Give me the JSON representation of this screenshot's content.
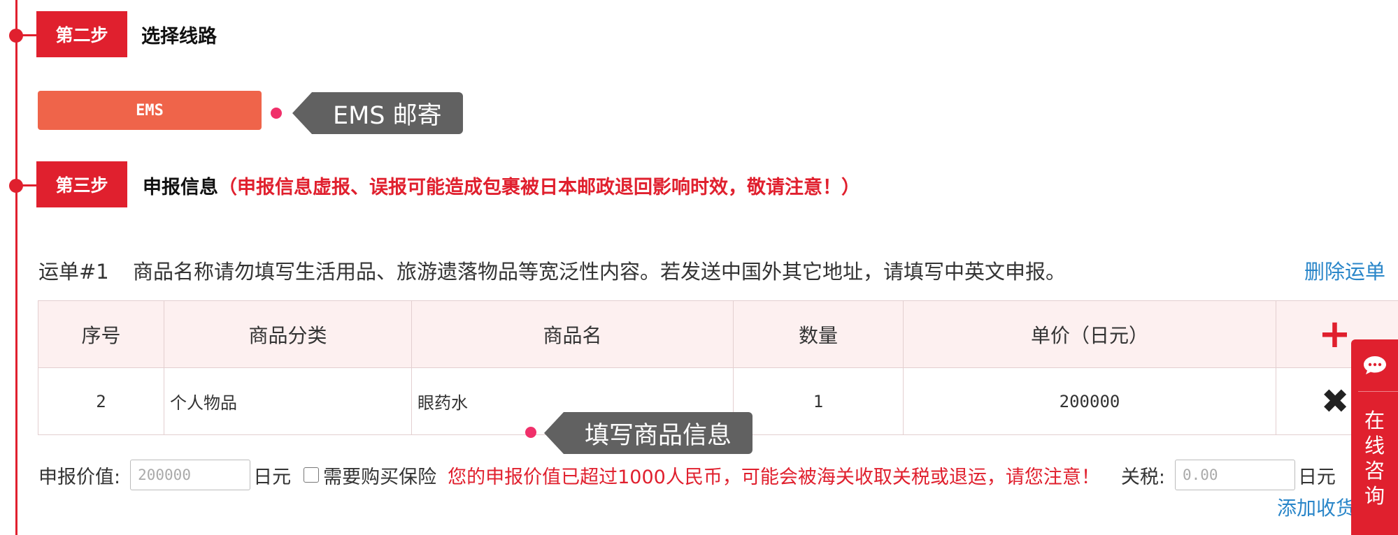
{
  "step2": {
    "badge": "第二步",
    "title": "选择线路"
  },
  "route": {
    "button_label": "EMS",
    "tooltip": "EMS 邮寄"
  },
  "step3": {
    "badge": "第三步",
    "title": "申报信息",
    "warning": "（申报信息虚报、误报可能造成包裹被日本邮政退回影响时效，敬请注意！）"
  },
  "waybill": {
    "label": "运单#1",
    "note": "商品名称请勿填写生活用品、旅游遗落物品等宽泛性内容。若发送中国外其它地址，请填写中英文申报。",
    "delete_label": "删除运单"
  },
  "table": {
    "headers": [
      "序号",
      "商品分类",
      "商品名",
      "数量",
      "单价（日元）"
    ],
    "add_icon": "plus-icon",
    "rows": [
      {
        "index": "2",
        "category": "个人物品",
        "name": "眼药水",
        "quantity": "1",
        "price": "200000",
        "remove_icon": "cross-icon"
      }
    ],
    "tooltip": "填写商品信息"
  },
  "declaration": {
    "value_label": "申报价值:",
    "value_placeholder": "200000",
    "currency": "日元",
    "insurance_label": "需要购买保险",
    "warning": "您的申报价值已超过1000人民币，可能会被海关收取关税或退运，请您注意！",
    "tariff_label": "关税:",
    "tariff_placeholder": "0.00",
    "tariff_currency": "日元",
    "add_address_label": "添加收货"
  },
  "consult": {
    "icon": "chat-icon",
    "label": "在线咨询"
  },
  "colors": {
    "accent": "#e0202e",
    "route_button": "#ef644a",
    "tooltip": "#616161",
    "link": "#2a86c9",
    "marker": "#f0306a"
  }
}
